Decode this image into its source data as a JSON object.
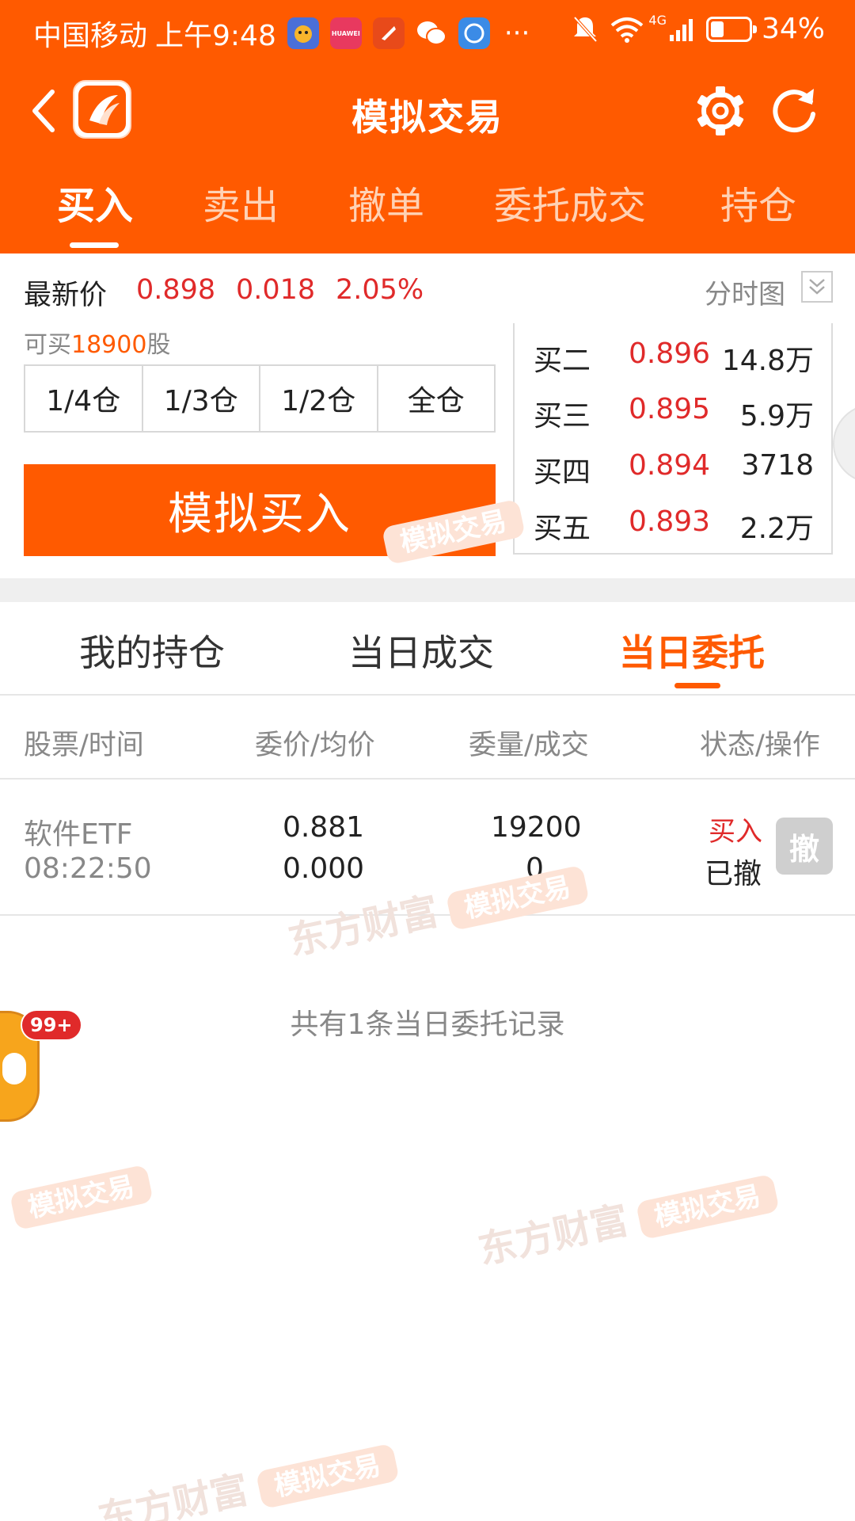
{
  "status_bar": {
    "carrier": "中国移动",
    "time": "上午9:48",
    "huawei_label": "HUAWEI",
    "more": "···",
    "network": "4G",
    "battery": "34%",
    "battery_level": 0.34
  },
  "nav": {
    "title": "模拟交易"
  },
  "top_tabs": [
    "买入",
    "卖出",
    "撤单",
    "委托成交",
    "持仓"
  ],
  "active_top_tab": "买入",
  "price": {
    "label": "最新价",
    "last": "0.898",
    "change": "0.018",
    "change_pct": "2.05%",
    "chart_label": "分时图"
  },
  "trade": {
    "buyable_prefix": "可买",
    "buyable_qty": "18900",
    "buyable_unit": "股",
    "positions": [
      "1/4仓",
      "1/3仓",
      "1/2仓",
      "全仓"
    ],
    "buy_label": "模拟买入"
  },
  "orderbook": [
    {
      "label": "买二",
      "price": "0.896",
      "vol": "14.8万"
    },
    {
      "label": "买三",
      "price": "0.895",
      "vol": "5.9万"
    },
    {
      "label": "买四",
      "price": "0.894",
      "vol": "3718"
    },
    {
      "label": "买五",
      "price": "0.893",
      "vol": "2.2万"
    }
  ],
  "bottom_tabs": [
    "我的持仓",
    "当日成交",
    "当日委托"
  ],
  "active_bottom_tab": "当日委托",
  "table": {
    "headers": [
      "股票/时间",
      "委价/均价",
      "委量/成交",
      "状态/操作"
    ],
    "rows": [
      {
        "stock": "软件ETF",
        "time": "08:22:50",
        "order_price": "0.881",
        "avg_price": "0.000",
        "order_qty": "19200",
        "filled": "0",
        "side": "买入",
        "status": "已撤",
        "action": "撤"
      }
    ]
  },
  "summary": "共有1条当日委托记录",
  "watermark": {
    "brand": "东方财富",
    "tag": "模拟交易"
  },
  "floating": {
    "badge": "99+"
  },
  "colors": {
    "brand_orange": "#ff5a00",
    "price_red": "#e02a2a",
    "muted_gray": "#888888"
  }
}
